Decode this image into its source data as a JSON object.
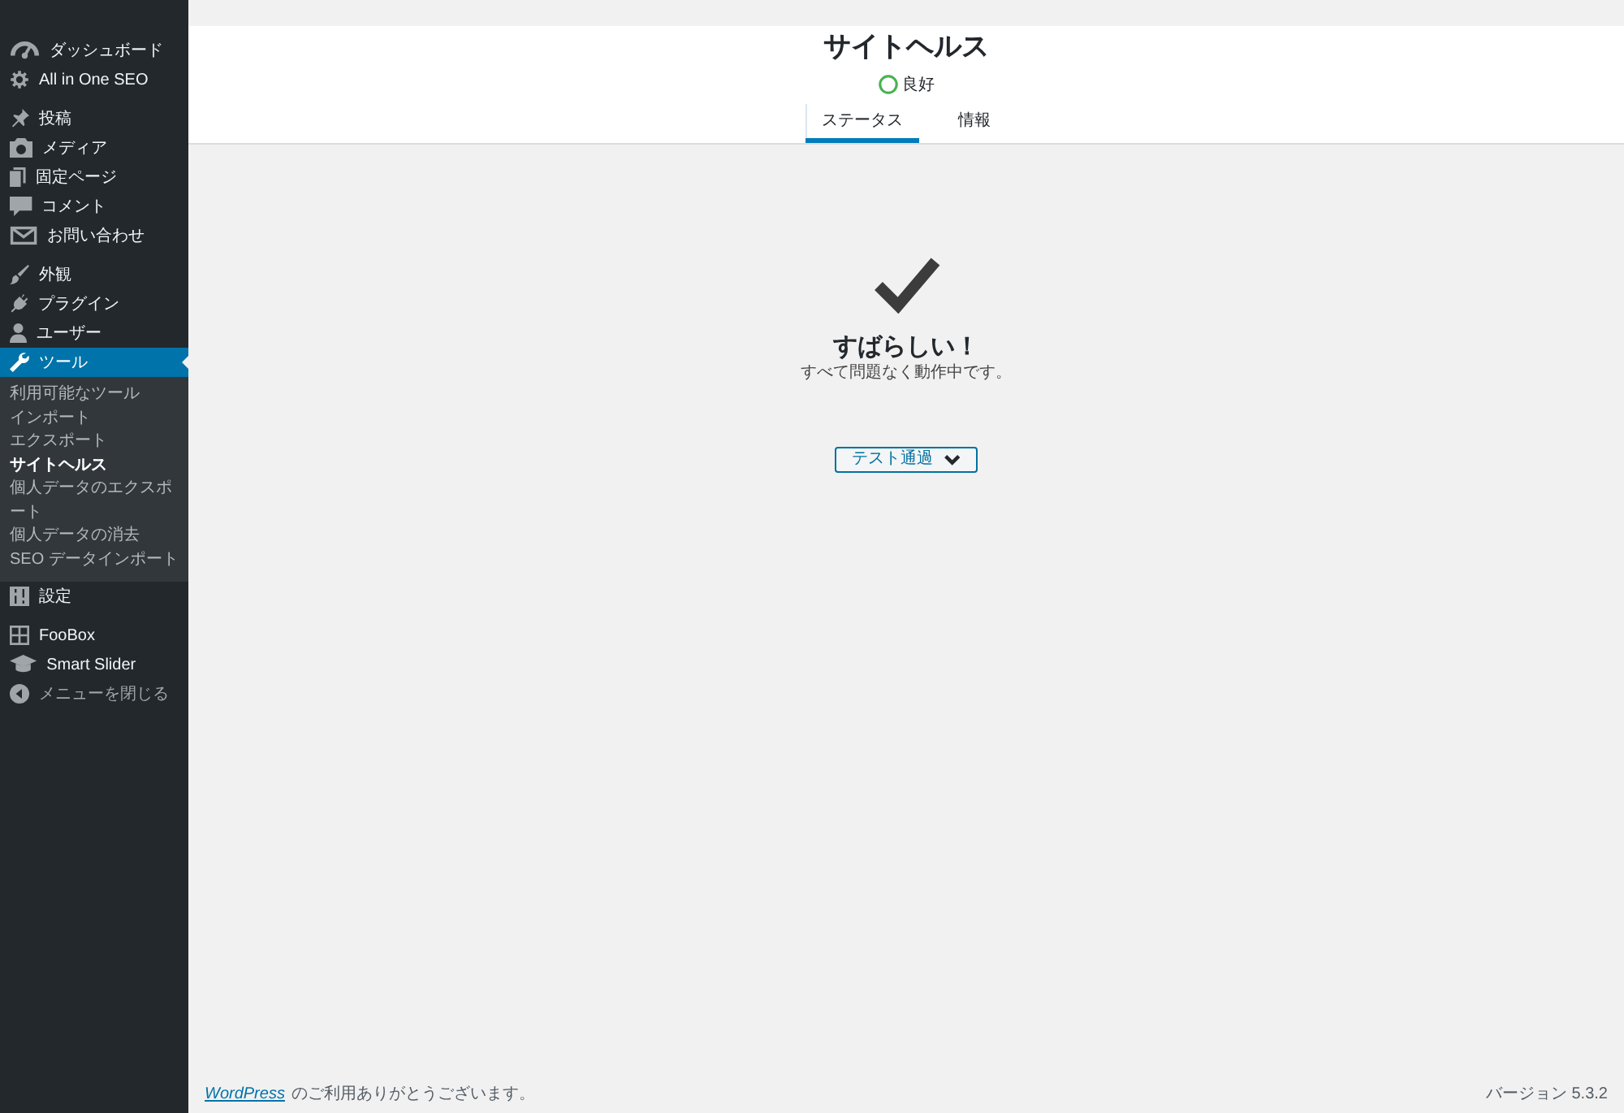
{
  "sidebar": {
    "groups": [
      {
        "items": [
          {
            "label": "ダッシュボード",
            "selected": false
          },
          {
            "label": "All in One SEO",
            "selected": false
          }
        ]
      },
      {
        "items": [
          {
            "label": "投稿",
            "selected": false
          },
          {
            "label": "メディア",
            "selected": false
          },
          {
            "label": "固定ページ",
            "selected": false
          },
          {
            "label": "コメント",
            "selected": false
          },
          {
            "label": "お問い合わせ",
            "selected": false
          }
        ]
      },
      {
        "items": [
          {
            "label": "外観",
            "selected": false
          },
          {
            "label": "プラグイン",
            "selected": false
          },
          {
            "label": "ユーザー",
            "selected": false
          },
          {
            "label": "ツール",
            "selected": true,
            "children": [
              {
                "label": "利用可能なツール",
                "selected": false
              },
              {
                "label": "インポート",
                "selected": false
              },
              {
                "label": "エクスポート",
                "selected": false
              },
              {
                "label": "サイトヘルス",
                "selected": true
              },
              {
                "label": "個人データのエクスポート",
                "selected": false
              },
              {
                "label": "個人データの消去",
                "selected": false
              },
              {
                "label": "SEO データインポート",
                "selected": false
              }
            ]
          },
          {
            "label": "設定",
            "selected": false
          }
        ]
      },
      {
        "items": [
          {
            "label": "FooBox",
            "selected": false
          },
          {
            "label": "Smart Slider",
            "selected": false
          }
        ]
      }
    ],
    "collapse_label": "メニューを閉じる"
  },
  "header": {
    "title": "サイトヘルス",
    "status": {
      "label": "良好",
      "level": 1
    }
  },
  "tabs": [
    {
      "label": "ステータス",
      "selected": true
    },
    {
      "label": "情報",
      "selected": false
    }
  ],
  "result": {
    "heading": "すばらしい！",
    "message": "すべて問題なく動作中です。",
    "passed_button": {
      "label": "テスト通過",
      "expanded": false
    }
  },
  "footer": {
    "link": "WordPress",
    "thanks": "のご利用ありがとうございます。",
    "version": "バージョン 5.3.2"
  }
}
